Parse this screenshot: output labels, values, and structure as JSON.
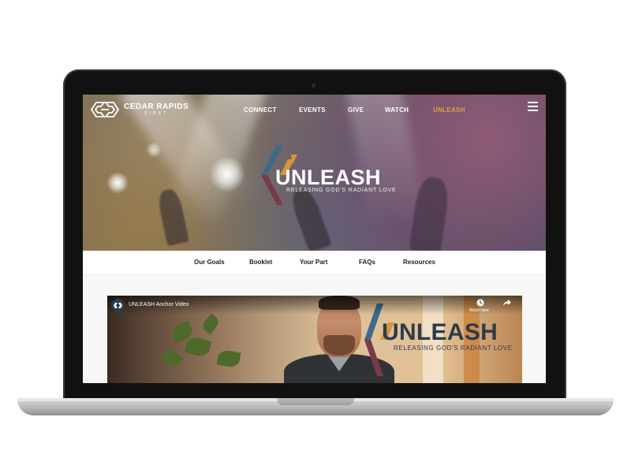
{
  "site": {
    "logo_name": "CEDAR RAPIDS",
    "logo_sub": "FIRST"
  },
  "nav": {
    "items": [
      {
        "label": "CONNECT",
        "active": false
      },
      {
        "label": "EVENTS",
        "active": false
      },
      {
        "label": "GIVE",
        "active": false
      },
      {
        "label": "WATCH",
        "active": false
      },
      {
        "label": "UNLEASH",
        "active": true
      }
    ],
    "menu_icon": "hamburger-icon"
  },
  "hero": {
    "title": "UNLEASH",
    "tagline": "RELEASING GOD'S RADIANT LOVE"
  },
  "subnav": {
    "items": [
      "Our Goals",
      "Booklet",
      "Your Part",
      "FAQs",
      "Resources"
    ]
  },
  "video": {
    "title": "UNLEASH Anchor Video",
    "watch_later": "Watch later",
    "overlay_title": "UNLEASH",
    "overlay_tagline": "RELEASING GOD'S RADIANT LOVE",
    "icons": [
      "clock-icon",
      "share-icon"
    ]
  },
  "colors": {
    "accent": "#e0a13a",
    "brand_navy": "#2f3a4a",
    "brand_teal": "#3d6a8a",
    "brand_orange": "#d8943a",
    "brand_maroon": "#7a3a4a"
  }
}
